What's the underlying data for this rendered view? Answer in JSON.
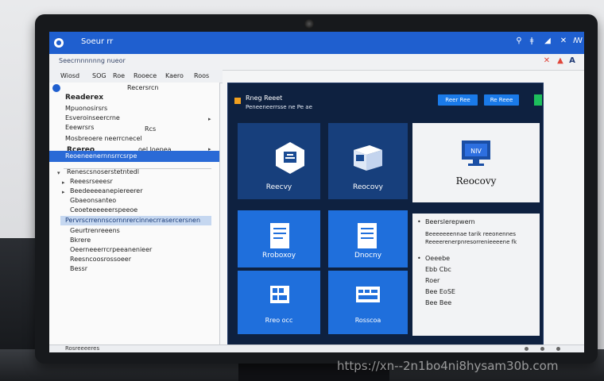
{
  "window": {
    "title": "Soeur rr",
    "controls": [
      "⚲",
      "ǂ",
      "◢",
      "✕",
      "ꟿ"
    ]
  },
  "subbar": {
    "path": "Seecrnnnnnng nueor",
    "icons": [
      "✕",
      "▲"
    ]
  },
  "menu": [
    "Wiosd",
    "SOG",
    "Roe",
    "Rooece",
    "Kaero",
    "Roos"
  ],
  "left_pane": {
    "rows": [
      {
        "text": "Readerex",
        "style": "bold"
      },
      {
        "text": "Mpuonosirsrs",
        "style": ""
      },
      {
        "text": "Esveroinseercrne",
        "style": ""
      },
      {
        "text": "Eeewrsrs",
        "style": ""
      },
      {
        "text": "Mosbreoere neerrcnecel",
        "style": ""
      },
      {
        "text": "Rcereo",
        "style": "bold"
      },
      {
        "text": "Renescsnoserstetntedl",
        "style": ""
      },
      {
        "text": "Reeesrseeesr",
        "style": ""
      },
      {
        "text": "Beedeeeeanepiereerer",
        "style": ""
      },
      {
        "text": "Gbaeonsanteo",
        "style": ""
      },
      {
        "text": "Ceoeteeeeeerspeeoe",
        "style": ""
      },
      {
        "text": "Geurtrenreeens",
        "style": ""
      },
      {
        "text": "Bkrere",
        "style": ""
      },
      {
        "text": "Oeerneeerrcrpeeanenieer",
        "style": ""
      },
      {
        "text": "Reesncoosrossoeer",
        "style": ""
      },
      {
        "text": "Bessr",
        "style": ""
      }
    ],
    "side_labels": [
      "Recersrcn",
      "Rcs",
      "oel loepea"
    ],
    "selected": "Reoeneenernnsrrcsrpe",
    "hovered": "Pervrscrrennscornnrercinnecrrasercersnen"
  },
  "right_pane": {
    "header_title": "Rneg Reeet",
    "header_sub": "Peneeneerrsse ne Pe ae",
    "buttons": [
      "Reer Ree",
      "Re Reee"
    ],
    "tiles": [
      {
        "label": "Reecvy"
      },
      {
        "label": "Reocovy"
      },
      {
        "label": "Reocovy",
        "screen_text": "NIV"
      },
      {
        "label": "Rroboxoy"
      },
      {
        "label": "Dnocny"
      },
      {
        "label": "Rreo occ"
      },
      {
        "label": "Rosscoa"
      }
    ],
    "info": {
      "title": "Beerslerepwern",
      "lines": [
        "Beeeeeeennae tarik reeonennes",
        "Reeeerenerpnresorrenieeeene fk"
      ],
      "list_title": "Oeeebe",
      "list": [
        "Ebb Cbc",
        "Roer",
        "Bee EoSE",
        "Bee Bee"
      ]
    }
  },
  "status": {
    "text": "Rosreeeeres"
  },
  "watermark": "https://xn--2n1bo4ni8hysam30b.com"
}
